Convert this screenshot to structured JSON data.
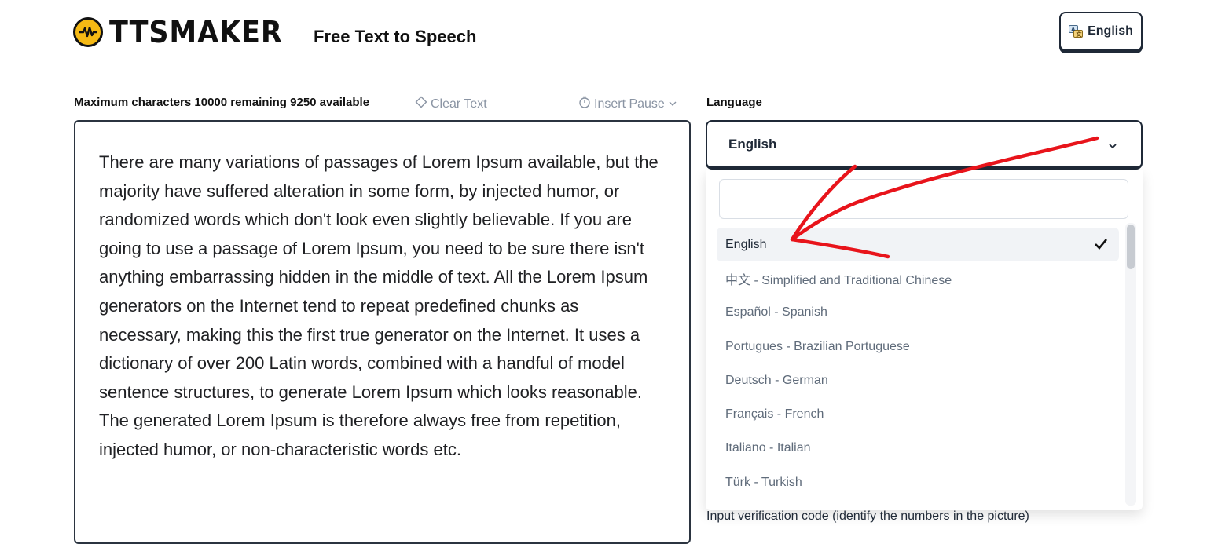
{
  "header": {
    "logo_text": "TTSMAKER",
    "tagline": "Free Text to Speech",
    "language_button": "English"
  },
  "toolbar": {
    "limits": "Maximum characters 10000 remaining 9250 available",
    "clear_text": "Clear Text",
    "insert_pause": "Insert Pause"
  },
  "editor": {
    "text": "There are many variations of passages of Lorem Ipsum available, but the majority have suffered alteration in some form, by injected humor, or randomized words which don't look even slightly believable. If you are going to use a passage of Lorem Ipsum, you need to be sure there isn't anything embarrassing hidden in the middle of text. All the Lorem Ipsum generators on the Internet tend to repeat predefined chunks as necessary, making this the first true generator on the Internet. It uses a dictionary of over 200 Latin words, combined with a handful of model sentence structures, to generate Lorem Ipsum which looks reasonable. The generated Lorem Ipsum is therefore always free from repetition, injected humor, or non-characteristic words etc."
  },
  "language": {
    "label": "Language",
    "selected": "English",
    "search_placeholder": "",
    "options": [
      {
        "label": "English"
      },
      {
        "label": "中文 - Simplified and Traditional Chinese"
      },
      {
        "label": "Español - Spanish"
      },
      {
        "label": "Portugues - Brazilian Portuguese"
      },
      {
        "label": "Deutsch - German"
      },
      {
        "label": "Français - French"
      },
      {
        "label": "Italiano - Italian"
      },
      {
        "label": "Türk - Turkish"
      }
    ]
  },
  "verification": {
    "label": "Input verification code (identify the numbers in the picture)"
  },
  "colors": {
    "logo_yellow": "#f5b914",
    "annotation_red": "#e8141b",
    "border_dark": "#1f2937"
  }
}
